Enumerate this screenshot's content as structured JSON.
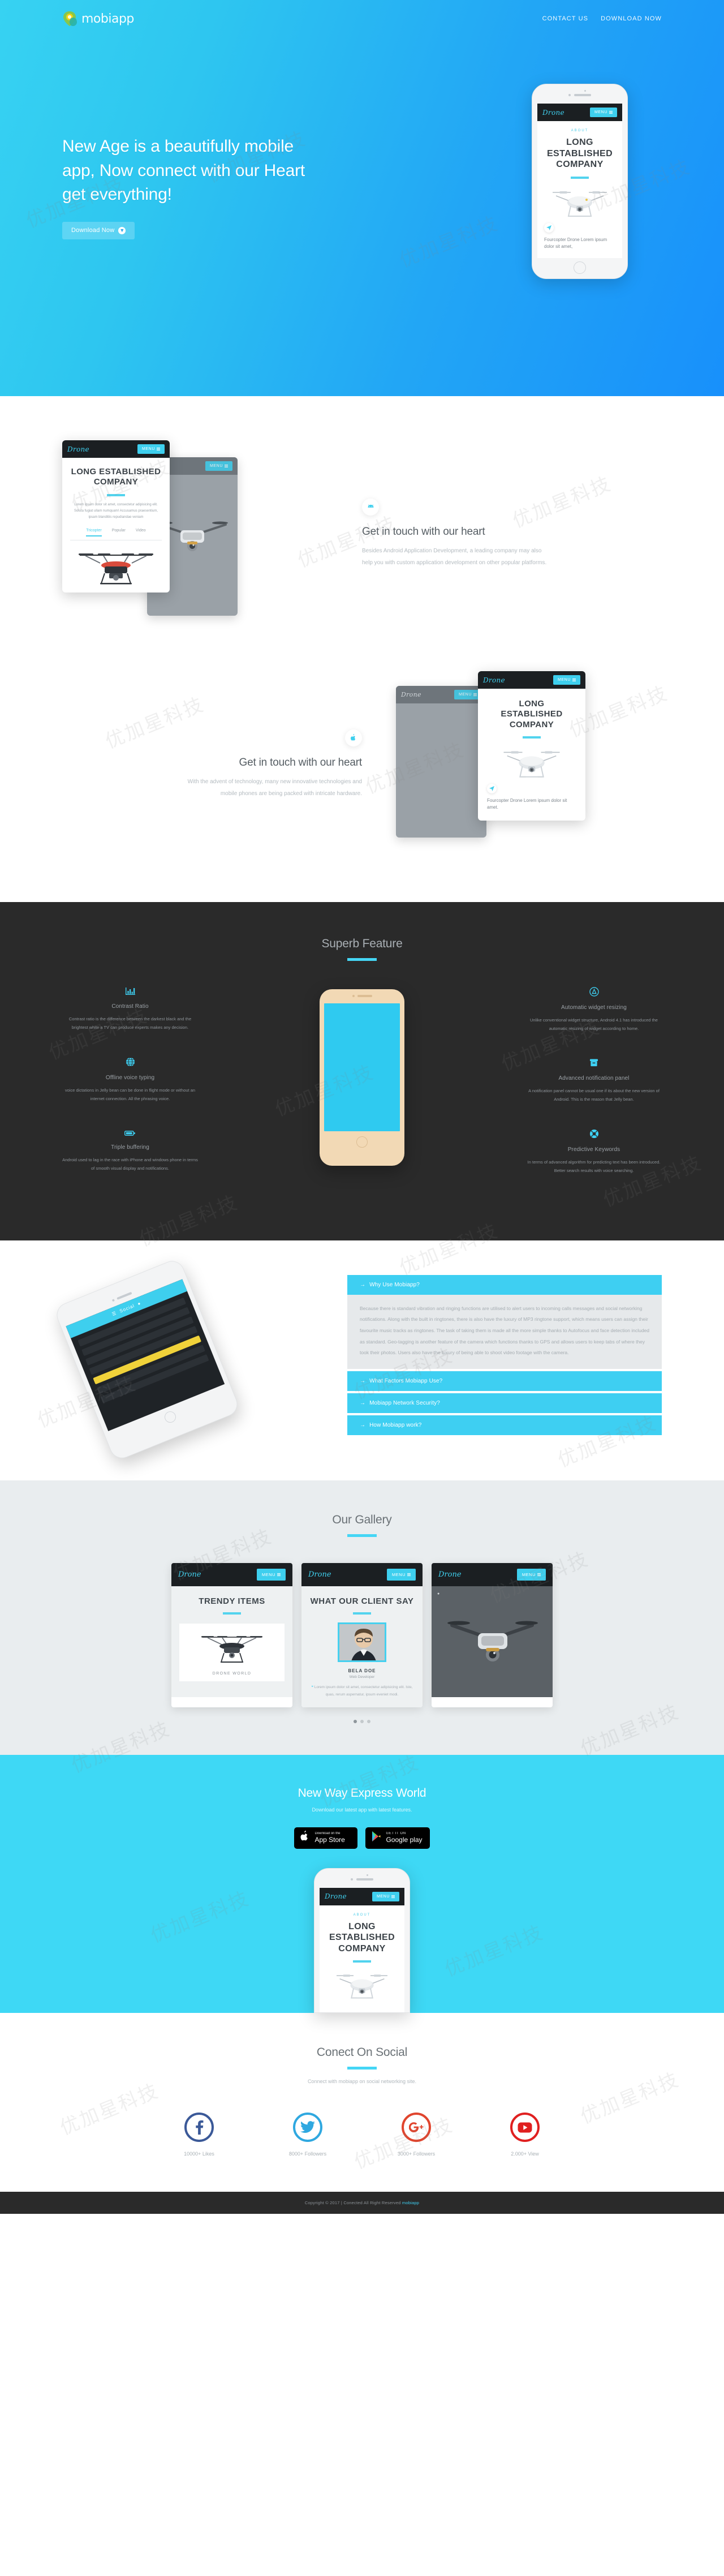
{
  "header": {
    "logo_text": "mobiapp",
    "nav": [
      {
        "label": "CONTACT US"
      },
      {
        "label": "DOWNLOAD NOW"
      }
    ]
  },
  "hero": {
    "heading": "New Age is a beautifully mobile app, Now connect with our Heart get everything!",
    "cta_label": "Download Now",
    "cta_icon": "download-circle-icon",
    "gradient_from": "#37d2f2",
    "gradient_to": "#1890fb",
    "phone": {
      "brand": "Drone",
      "menu_label": "MENU",
      "kicker": "ABOUT",
      "title": "LONG ESTABLISHED COMPANY",
      "caption": "Fourcopter Drone Lorem ipsum dolor sit amet,"
    }
  },
  "features_alt": {
    "row1": {
      "icon": "android-icon",
      "heading": "Get in touch with our heart",
      "body": "Besides Android Application Development, a leading company may also help you with custom application development on other popular platforms.",
      "phone": {
        "brand": "Drone",
        "menu_label": "MENU",
        "title": "LONG ESTABLISHED COMPANY",
        "paragraph": "Lorem ipsum dolor sit amet, consectetur adipisicing elit. Soluta fugiat ullam numquam! Accusamus praesentium, ipsam blanditiis repudiandae veniam",
        "tabs": [
          {
            "label": "Tricopter",
            "active": true
          },
          {
            "label": "Popular",
            "active": false
          },
          {
            "label": "Video",
            "active": false
          }
        ]
      }
    },
    "row2": {
      "icon": "apple-icon",
      "heading": "Get in touch with our heart",
      "body": "With the advent of technology, many new innovative technologies and mobile phones are being packed with intricate hardware.",
      "phone": {
        "brand": "Drone",
        "menu_label": "MENU",
        "title": "LONG ESTABLISHED COMPANY",
        "caption": "Fourcopter Drone Lorem ipsum dolor sit amet."
      }
    }
  },
  "superb": {
    "title": "Superb Feature",
    "accent": "#45d6f5",
    "left_items": [
      {
        "icon": "chart-bar-icon",
        "glyph": "ὌA",
        "title": "Contrast Ratio",
        "body": "Contrast ratio is the difference between the darkest black and the brightest white a TV can produce experts makes any decision."
      },
      {
        "icon": "globe-icon",
        "title": "Offline voice typing",
        "body": "voice dictations in Jelly bean can be done in flight mode or without an internet connection. All the phrasing voice."
      },
      {
        "icon": "battery-icon",
        "title": "Triple buffering",
        "body": "Android used to lag in the race with iPhone and windows phone in terms of smooth visual display and notifications."
      }
    ],
    "right_items": [
      {
        "icon": "appstore-icon",
        "title": "Automatic widget resizing",
        "body": "Unlike conventional widget structure, Android 4.1 has introduced the automatic resizing of widget according to home."
      },
      {
        "icon": "archive-box-icon",
        "title": "Advanced notification panel",
        "body": "A notification panel cannot be usual one if its about the new version of Android. This is the reason that Jelly bean."
      },
      {
        "icon": "target-icon",
        "title": "Predictive Keywords",
        "body": "In terms of advanced algorithm for predicting text has been introduced. Better search results with voice searching."
      }
    ]
  },
  "faq": {
    "items": [
      {
        "arrow": "arrow-right-icon",
        "question": "Why Use Mobiapp?",
        "expanded": true,
        "answer": "Because there is standard vibration and ringing functions are utilised to alert users to incoming calls messages and social networking notifications. Along with the built in ringtones, there is also have the luxury of MP3 ringtone support, which means users can assign their favourite music tracks as ringtones. The task of taking them is made all the more simple thanks to Autofocus and face detection included as standard. Geo-tagging is another feature of the camera which functions thanks to GPS and allows users to keep tabs of where they took their photos. Users also have the luxury of being able to shoot video footage with the camera."
      },
      {
        "arrow": "arrow-right-icon",
        "question": "What Factors Mobiapp Use?",
        "expanded": false,
        "answer": ""
      },
      {
        "arrow": "arrow-right-icon",
        "question": "Mobiapp Network Security?",
        "expanded": false,
        "answer": ""
      },
      {
        "arrow": "arrow-right-icon",
        "question": "How Mobiapp work?",
        "expanded": false,
        "answer": ""
      }
    ]
  },
  "gallery": {
    "title": "Our Gallery",
    "cards": [
      {
        "brand": "Drone",
        "menu_label": "MENU",
        "title": "TRENDY ITEMS",
        "product_name": "DRONE WORLD"
      },
      {
        "brand": "Drone",
        "menu_label": "MENU",
        "title": "WHAT OUR CLIENT SAY",
        "person_name": "BELA DOE",
        "person_role": "Web Developer",
        "quote": "Lorem ipsum dolor sit amet, consectetur adipisicing elit. Iste, quas, rerum aspernatur, ipsum eveniet modi."
      },
      {
        "brand": "Drone",
        "menu_label": "MENU"
      }
    ],
    "dots": [
      {
        "active": true
      },
      {
        "active": false
      },
      {
        "active": false
      }
    ]
  },
  "express": {
    "title": "New Way Express World",
    "subtitle": "Download our latest app with latest features.",
    "stores": [
      {
        "icon": "apple-icon",
        "line1": "Download on the",
        "line2": "App Store"
      },
      {
        "icon": "google-play-icon",
        "line1": "GET IT ON",
        "line2": "Google play"
      }
    ],
    "phone": {
      "brand": "Drone",
      "menu_label": "MENU",
      "kicker": "ABOUT",
      "title": "LONG ESTABLISHED COMPANY"
    }
  },
  "social": {
    "title": "Conect On Social",
    "subtitle": "Connect with mobiapp on social networking site.",
    "items": [
      {
        "icon": "facebook-icon",
        "label": "10000+ Likes",
        "color": "#3b5998"
      },
      {
        "icon": "twitter-icon",
        "label": "8000+ Followers",
        "color": "#2fa8e0"
      },
      {
        "icon": "google-plus-icon",
        "label": "3000+ Followers",
        "color": "#e0452e"
      },
      {
        "icon": "youtube-icon",
        "label": "2.000+ View",
        "color": "#e02020"
      }
    ]
  },
  "footer": {
    "text": "Copyright © 2017 | Conected All Right Reserved",
    "link": "mobiapp"
  },
  "watermark": {
    "text": "优加星科技"
  }
}
